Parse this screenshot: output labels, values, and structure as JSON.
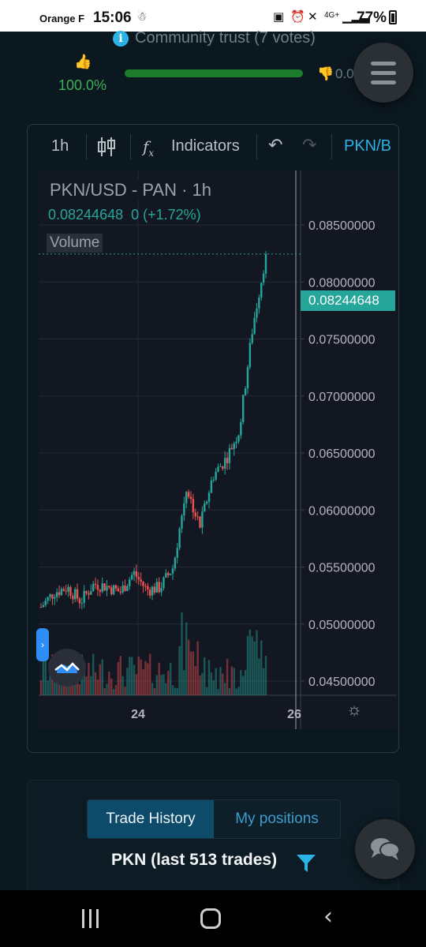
{
  "status_bar": {
    "carrier": "Orange F",
    "time": "15:06",
    "battery": "77%"
  },
  "trust": {
    "title": "Community trust (7 votes)",
    "upvote_pct": "100.0%",
    "downvote_pct": "0.0",
    "upvote_share": 1.0
  },
  "chart": {
    "toolbar": {
      "interval": "1h",
      "indicators": "Indicators",
      "symbol": "PKN/B"
    },
    "legend": {
      "title": "PKN/USD - PAN · 1h",
      "price": "0.08244648",
      "change": "0 (+1.72%)",
      "volume": "Volume"
    },
    "last_price_tag": "0.08244648",
    "colors": {
      "up": "#26a69a",
      "down": "#ef5350",
      "bg": "#131722"
    }
  },
  "chart_data": {
    "type": "candlestick",
    "title": "PKN/USD - PAN · 1h",
    "y_ticks": [
      "0.08500000",
      "0.08000000",
      "0.07500000",
      "0.07000000",
      "0.06500000",
      "0.06000000",
      "0.05500000",
      "0.05000000",
      "0.04500000"
    ],
    "x_ticks": [
      "24",
      "26"
    ],
    "ylim": [
      0.0425,
      0.0875
    ],
    "last_price": 0.08244648,
    "trend": [
      0.0515,
      0.0528,
      0.0532,
      0.052,
      0.0535,
      0.0533,
      0.0528,
      0.0545,
      0.053,
      0.0532,
      0.055,
      0.062,
      0.0585,
      0.063,
      0.0645,
      0.067,
      0.076,
      0.0824
    ]
  },
  "trade_panel": {
    "tab_active": "Trade History",
    "tab_inactive": "My positions",
    "title": "PKN (last 513 trades)"
  }
}
